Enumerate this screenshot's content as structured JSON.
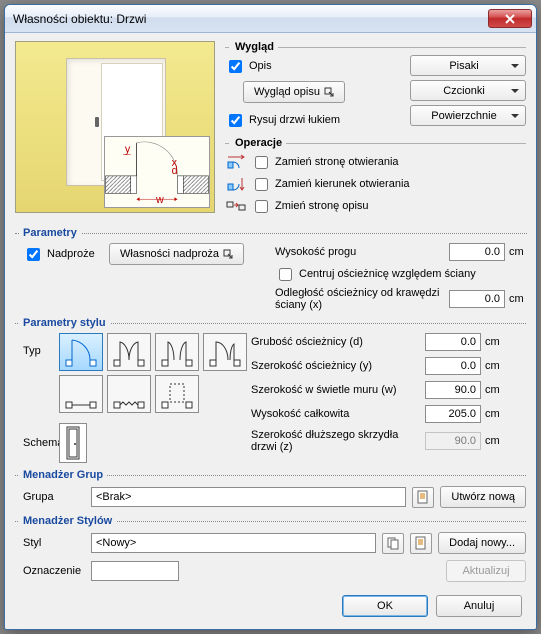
{
  "window": {
    "title": "Własności obiektu: Drzwi",
    "close_icon": "close"
  },
  "sections": {
    "wyglad": "Wygląd",
    "operacje": "Operacje",
    "parametry": "Parametry",
    "parametry_stylu": "Parametry stylu",
    "menadzer_grup": "Menadżer Grup",
    "menadzer_stylow": "Menadżer Stylów"
  },
  "wyglad": {
    "opis_label": "Opis",
    "opis_checked": true,
    "wyglad_opisu_btn": "Wygląd opisu",
    "rysuj_lukiem_label": "Rysuj drzwi łukiem",
    "rysuj_lukiem_checked": true,
    "dropdowns": {
      "pisaki": "Pisaki",
      "czcionki": "Czcionki",
      "powierzchnie": "Powierzchnie"
    }
  },
  "operacje": {
    "zamien_strone": "Zamień stronę otwierania",
    "zamien_kierunek": "Zamień kierunek otwierania",
    "zmien_strone_opisu": "Zmień stronę opisu"
  },
  "parametry": {
    "nadproze_label": "Nadproże",
    "nadproze_checked": true,
    "wlasnosci_nadproza_btn": "Własności nadproża",
    "wysokosc_progu_label": "Wysokość progu",
    "wysokosc_progu_value": "0.0",
    "centruj_label": "Centruj ościeżnicę względem ściany",
    "centruj_checked": false,
    "odleglosc_label": "Odległość ościeżnicy od krawędzi ściany (x)",
    "odleglosc_value": "0.0",
    "unit": "cm"
  },
  "parametry_stylu": {
    "typ_label": "Typ",
    "schemat_label": "Schemat",
    "grubosc_d_label": "Grubość ościeżnicy (d)",
    "grubosc_d_value": "0.0",
    "szerokosc_y_label": "Szerokość ościeżnicy (y)",
    "szerokosc_y_value": "0.0",
    "szerokosc_w_label": "Szerokość w świetle muru (w)",
    "szerokosc_w_value": "90.0",
    "wysokosc_calk_label": "Wysokość całkowita",
    "wysokosc_calk_value": "205.0",
    "szerokosc_z_label": "Szerokość dłuższego skrzydła drzwi (z)",
    "szerokosc_z_value": "90.0",
    "unit": "cm"
  },
  "grup": {
    "grupa_label": "Grupa",
    "grupa_value": "<Brak>",
    "utworz_btn": "Utwórz nową"
  },
  "stylow": {
    "styl_label": "Styl",
    "styl_value": "<Nowy>",
    "dodaj_btn": "Dodaj nowy...",
    "oznaczenie_label": "Oznaczenie",
    "oznaczenie_value": "",
    "aktualizuj_btn": "Aktualizuj"
  },
  "footer": {
    "ok": "OK",
    "anuluj": "Anuluj"
  }
}
